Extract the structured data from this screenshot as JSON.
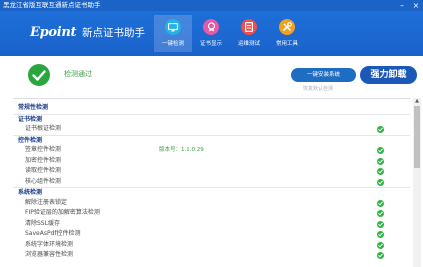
{
  "titlebar": {
    "title": "黑龙江省版互联互通新点证书助手",
    "minimize": "–",
    "close": "×"
  },
  "header": {
    "logo_text": "Epoint",
    "logo_sub": "新点证书助手",
    "nav": [
      {
        "label": "一键检测",
        "icon": "monitor-icon",
        "color": "#23b1e6",
        "active": true
      },
      {
        "label": "证书显示",
        "icon": "certificate-icon",
        "color": "#e45aa4",
        "active": false
      },
      {
        "label": "运维测试",
        "icon": "document-icon",
        "color": "#ef4e4e",
        "active": false
      },
      {
        "label": "常用工具",
        "icon": "tools-icon",
        "color": "#f2a020",
        "active": false
      }
    ]
  },
  "status": {
    "text": "检测通过",
    "start_button": "一键安装系统",
    "uninstall_button": "强力卸载",
    "restore_link": "恢复默认检测"
  },
  "list": {
    "rows": [
      {
        "type": "section",
        "label": "常规性检测",
        "sep": false
      },
      {
        "type": "section",
        "label": "证书检测",
        "sep": true
      },
      {
        "type": "item",
        "label": "证书根证检测",
        "ok": true,
        "boxed": false
      },
      {
        "type": "section",
        "label": "控件检测",
        "sep": true
      },
      {
        "type": "item",
        "label": "签章控件检测",
        "version": "版本号：1.1.0.29",
        "ok": true,
        "boxed": false
      },
      {
        "type": "item",
        "label": "加密控件检测",
        "ok": true,
        "boxed": false
      },
      {
        "type": "item",
        "label": "读取控件检测",
        "ok": true,
        "boxed": false
      },
      {
        "type": "item",
        "label": "核心组件检测",
        "ok": true,
        "boxed": false
      },
      {
        "type": "section",
        "label": "系统检测",
        "sep": true
      },
      {
        "type": "item",
        "label": "解除注册表锁定",
        "ok": true,
        "boxed": false
      },
      {
        "type": "item",
        "label": "FIP验证层的加解密算法检测",
        "ok": true,
        "boxed": false
      },
      {
        "type": "item",
        "label": "清除SSL缓存",
        "ok": true,
        "boxed": false
      },
      {
        "type": "item",
        "label": "SaveAsPdf控件检测",
        "ok": true,
        "boxed": false
      },
      {
        "type": "item",
        "label": "系统字体环境检测",
        "ok": true,
        "boxed": false
      },
      {
        "type": "item",
        "label": "浏览器兼容性检测",
        "ok": true,
        "boxed": false
      }
    ]
  },
  "colors": {
    "header": "#1a62cb",
    "ok_green": "#2fb344",
    "section_blue": "#1d3e8a"
  }
}
